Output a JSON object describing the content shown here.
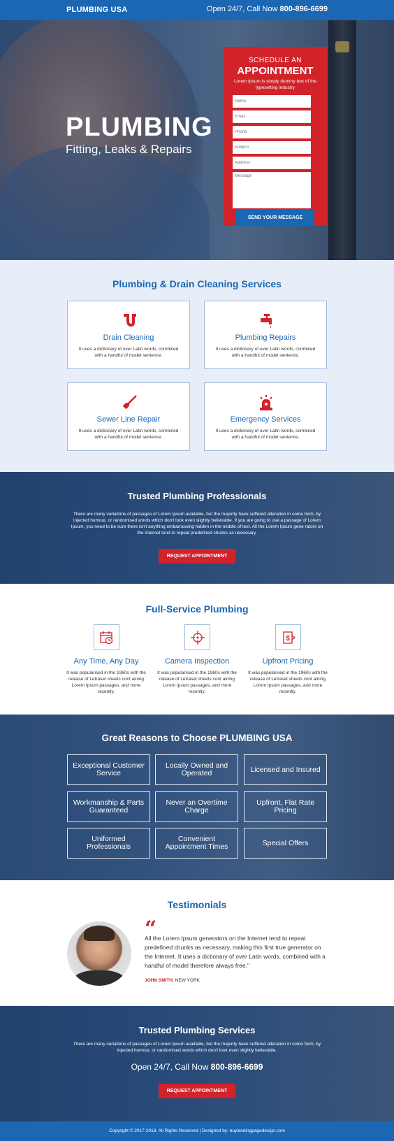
{
  "header": {
    "logo": "PLUMBING USA",
    "call_prefix": "Open 24/7, Call Now",
    "phone": "800-896-6699"
  },
  "hero": {
    "title": "PLUMBING",
    "subtitle": "Fitting, Leaks & Repairs"
  },
  "form": {
    "pre_title": "SCHEDULE AN",
    "title": "APPOINTMENT",
    "description": "Lorem Ipsum is simply dummy text of the typesetting industry",
    "fields": [
      "Name",
      "Email",
      "Phone",
      "Subject",
      "Address"
    ],
    "message_placeholder": "Message",
    "submit_label": "SEND YOUR MESSAGE"
  },
  "services": {
    "title": "Plumbing & Drain Cleaning Services",
    "items": [
      {
        "name": "Drain Cleaning",
        "desc": "It uses a dictionary of over Latin words, combined with a handful of model sentence.",
        "icon": "drain-pipe-icon"
      },
      {
        "name": "Plumbing Repairs",
        "desc": "It uses a dictionary of over Latin words, combined with a handful of model sentence.",
        "icon": "faucet-icon"
      },
      {
        "name": "Sewer Line Repair",
        "desc": "It uses a dictionary of over Latin words, combined with a handful of model sentence.",
        "icon": "plunger-icon"
      },
      {
        "name": "Emergency Services",
        "desc": "It uses a dictionary of over Latin words, combined with a handful of model sentence.",
        "icon": "siren-icon"
      }
    ]
  },
  "trusted": {
    "title": "Trusted Plumbing Professionals",
    "text": "There are many variations of passages of Lorem Ipsum available, but the majority have suffered alteration in some form, by injected humour, or randomised words which don't look even slightly believable. If you are going to use a passage of Lorem Ipsum, you need to be sure there isn't anything embarrassing hidden in the middle of text. All the Lorem Ipsum gene rators on the Internet tend to repeat predefined chunks as necessary.",
    "button": "REQUEST APPOINTMENT"
  },
  "full_service": {
    "title": "Full-Service Plumbing",
    "items": [
      {
        "name": "Any Time, Any Day",
        "desc": "It was popularised in the 1960s with the release of Letraset sheets cont aining Lorem Ipsum passages, and more recently.",
        "icon": "calendar-clock-icon"
      },
      {
        "name": "Camera Inspection",
        "desc": "It was popularised in the 1960s with the release of Letraset sheets cont aining Lorem Ipsum passages, and more recently.",
        "icon": "crosshair-icon"
      },
      {
        "name": "Upfront Pricing",
        "desc": "It was popularised in the 1960s with the release of Letraset sheets cont aining Lorem Ipsum passages, and more recently.",
        "icon": "price-tag-icon"
      }
    ]
  },
  "reasons": {
    "title": "Great Reasons to Choose PLUMBING USA",
    "items": [
      "Exceptional Customer Service",
      "Locally Owned and Operated",
      "Licensed and Insured",
      "Workmanship & Parts Guaranteed",
      "Never an Overtime Charge",
      "Upfront, Flat Rate Pricing",
      "Uniformed Professionals",
      "Convenient Appointment Times",
      "Special Offers"
    ]
  },
  "testimonials": {
    "title": "Testimonials",
    "quote": "All the Lorem Ipsum generators on the Internet tend to repeat predefined chunks as necessary, making this first true generator on the Internet. It uses a dictionary of over Latin words, combined with a handful of model therefore always free.\"",
    "author_name": "JOHN SMITH",
    "author_location": ", NEW YORK"
  },
  "trusted_services": {
    "title": "Trusted Plumbing Services",
    "text": "There are many variations of passages of Lorem Ipsum available, but the majority have suffered alteration in some form, by injected humour, or randomised words which don't look even slightly believable.",
    "call_prefix": "Open 24/7, Call Now",
    "phone": "800-896-6699",
    "button": "REQUEST APPOINTMENT"
  },
  "footer": {
    "text": "Copyright © 2017-2018. All Rights Reserved  |  Designed by: buylandingpagedesign.com"
  },
  "colors": {
    "primary_blue": "#1b67b3",
    "accent_red": "#d2232a",
    "services_bg": "#e8eef8"
  }
}
